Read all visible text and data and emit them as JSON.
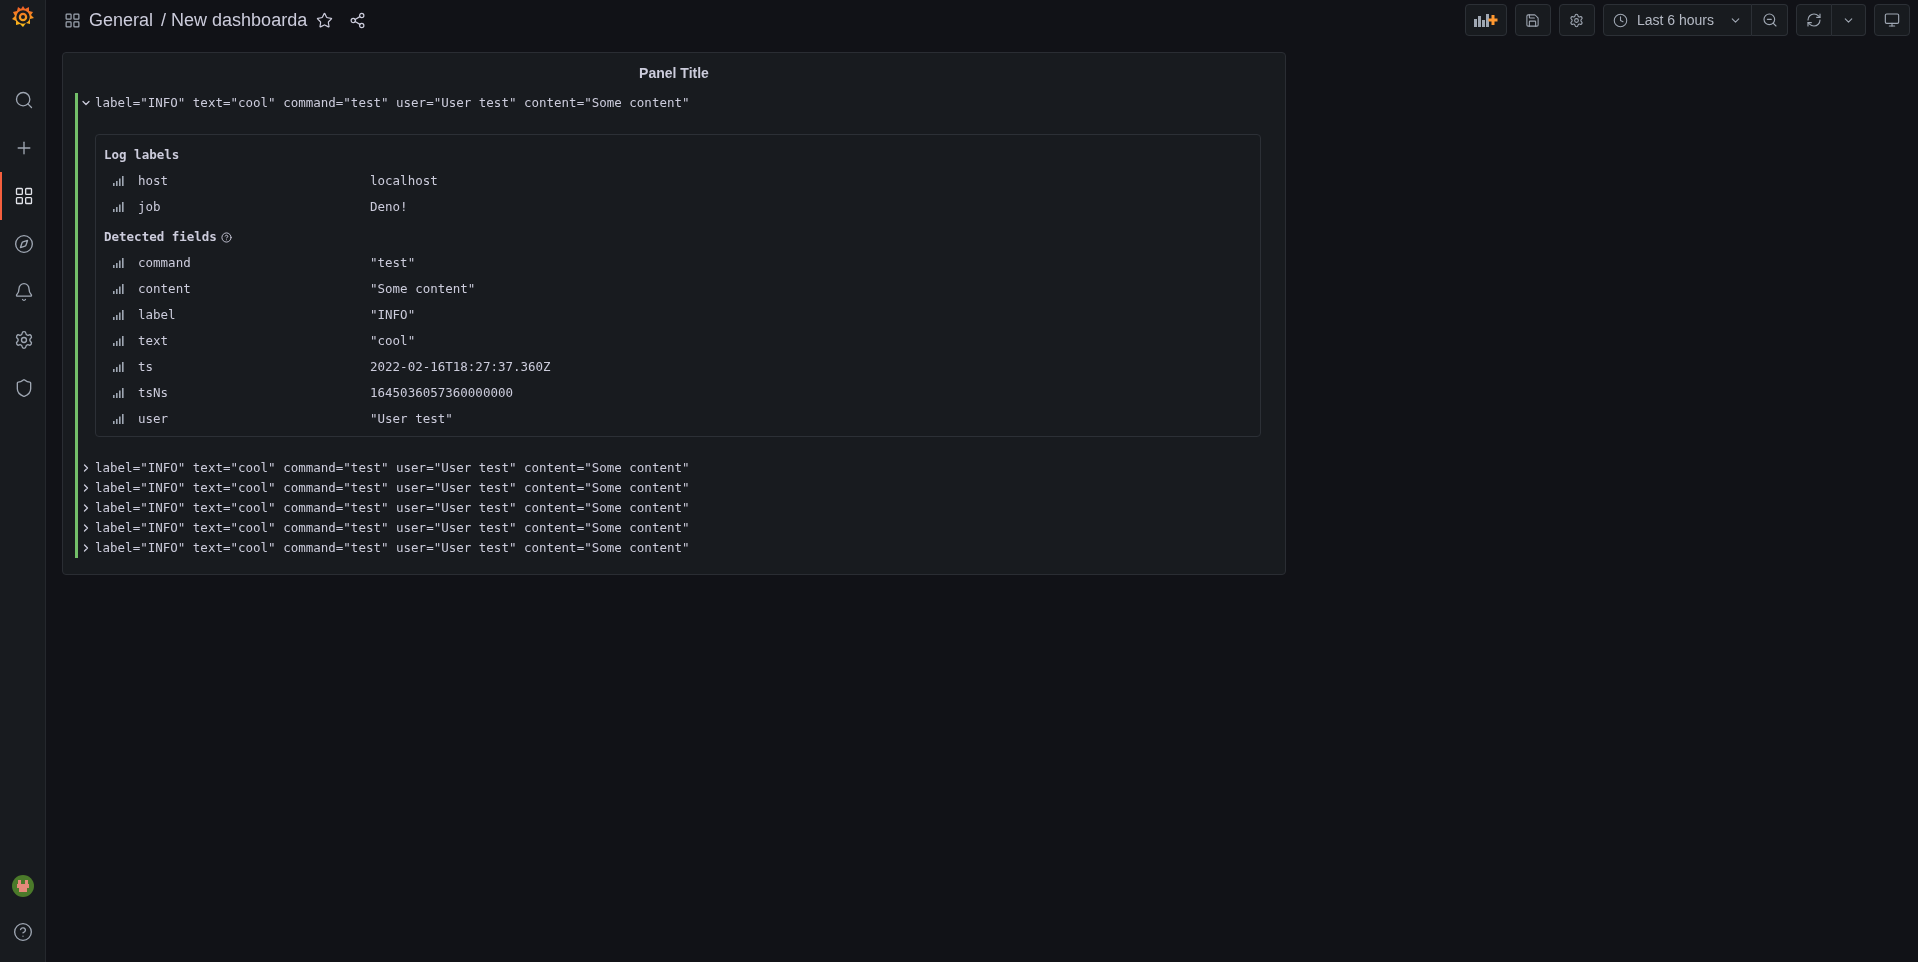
{
  "sidebar": {
    "items": [
      {
        "kind": "search",
        "selected": false
      },
      {
        "kind": "create",
        "selected": false
      },
      {
        "kind": "dashboards",
        "selected": true
      },
      {
        "kind": "explore",
        "selected": false
      },
      {
        "kind": "alerting",
        "selected": false
      },
      {
        "kind": "settings",
        "selected": false
      },
      {
        "kind": "admin",
        "selected": false
      }
    ],
    "bottom": [
      {
        "kind": "avatar"
      },
      {
        "kind": "help"
      }
    ]
  },
  "breadcrumb": {
    "folder": "General",
    "separator": "/",
    "title": "New dashboarda"
  },
  "toolbar": {
    "time_range": "Last 6 hours"
  },
  "panel": {
    "title": "Panel Title",
    "logs": [
      {
        "line": "label=\"INFO\" text=\"cool\" command=\"test\" user=\"User test\" content=\"Some content\"",
        "expanded": true,
        "details": [
          {
            "kind": "labels",
            "title": "Log labels",
            "fields": [
              {
                "name": "host",
                "value": "localhost"
              },
              {
                "name": "job",
                "value": "Deno!"
              }
            ]
          },
          {
            "kind": "detected",
            "title": "Detected fields",
            "fields": [
              {
                "name": "command",
                "value": "\"test\""
              },
              {
                "name": "content",
                "value": "\"Some content\""
              },
              {
                "name": "label",
                "value": "\"INFO\""
              },
              {
                "name": "text",
                "value": "\"cool\""
              },
              {
                "name": "ts",
                "value": "2022-02-16T18:27:37.360Z"
              },
              {
                "name": "tsNs",
                "value": "1645036057360000000"
              },
              {
                "name": "user",
                "value": "\"User test\""
              }
            ]
          }
        ]
      },
      {
        "line": "label=\"INFO\" text=\"cool\" command=\"test\" user=\"User test\" content=\"Some content\"",
        "expanded": false
      },
      {
        "line": "label=\"INFO\" text=\"cool\" command=\"test\" user=\"User test\" content=\"Some content\"",
        "expanded": false
      },
      {
        "line": "label=\"INFO\" text=\"cool\" command=\"test\" user=\"User test\" content=\"Some content\"",
        "expanded": false
      },
      {
        "line": "label=\"INFO\" text=\"cool\" command=\"test\" user=\"User test\" content=\"Some content\"",
        "expanded": false
      },
      {
        "line": "label=\"INFO\" text=\"cool\" command=\"test\" user=\"User test\" content=\"Some content\"",
        "expanded": false
      }
    ]
  }
}
